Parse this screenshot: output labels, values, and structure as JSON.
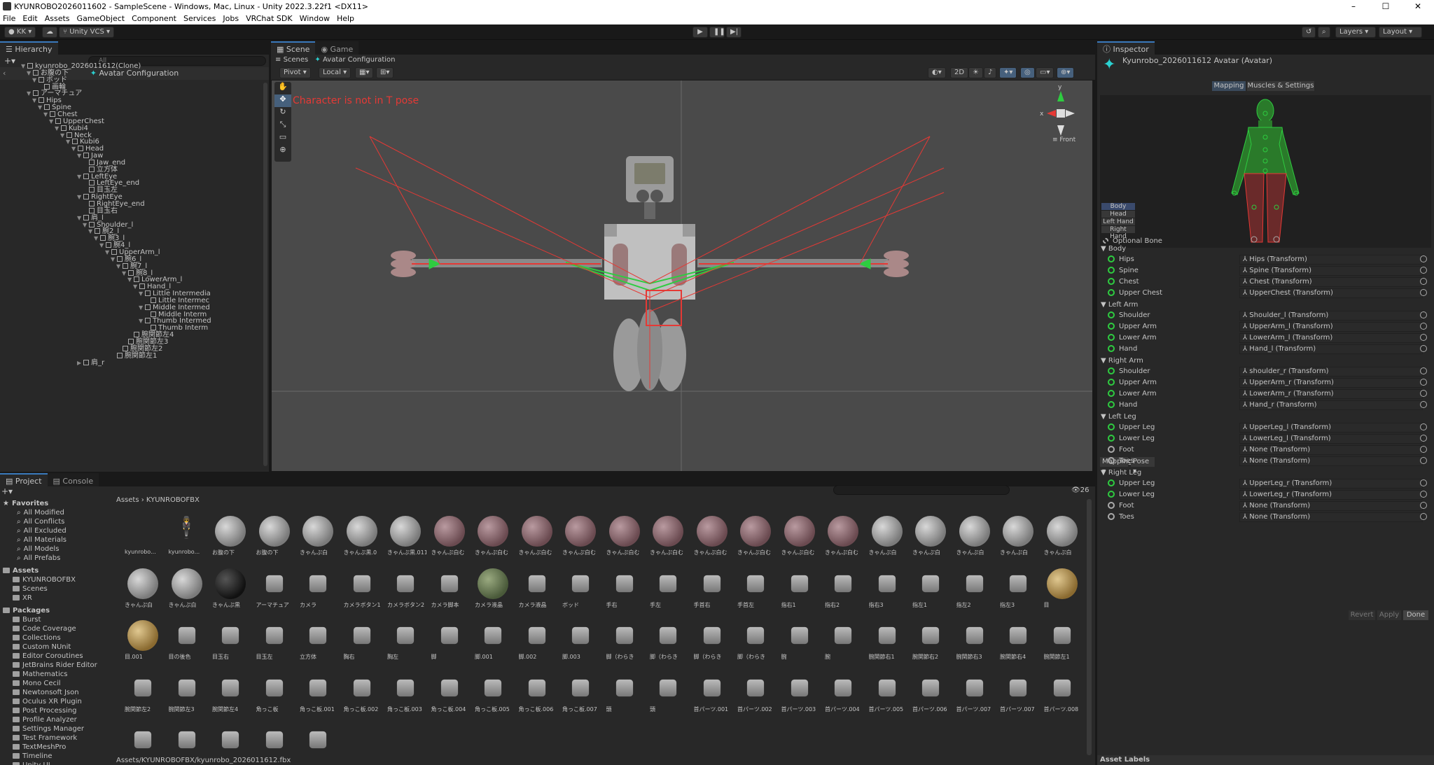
{
  "window": {
    "title": "KYUNROBO2026011602 - SampleScene - Windows, Mac, Linux - Unity 2022.3.22f1 <DX11>",
    "controls": [
      "–",
      "☐",
      "✕"
    ]
  },
  "menu": [
    "File",
    "Edit",
    "Assets",
    "GameObject",
    "Component",
    "Services",
    "Jobs",
    "VRChat SDK",
    "Window",
    "Help"
  ],
  "toolbar": {
    "account": "KK",
    "vcs": "Unity VCS",
    "layers": "Layers",
    "layout": "Layout"
  },
  "hierarchy": {
    "tab": "Hierarchy",
    "search_placeholder": "All",
    "header": "Avatar Configuration",
    "rows": [
      {
        "t": "kyunrobo_2026011612(Clone)",
        "d": 0,
        "a": "▼"
      },
      {
        "t": "お腹の下",
        "d": 1,
        "a": "▼"
      },
      {
        "t": "ボッド",
        "d": 2,
        "a": "▼"
      },
      {
        "t": "画輪",
        "d": 3,
        "a": ""
      },
      {
        "t": "アーマチュア",
        "d": 1,
        "a": "▼"
      },
      {
        "t": "Hips",
        "d": 2,
        "a": "▼"
      },
      {
        "t": "Spine",
        "d": 3,
        "a": "▼"
      },
      {
        "t": "Chest",
        "d": 4,
        "a": "▼"
      },
      {
        "t": "UpperChest",
        "d": 5,
        "a": "▼"
      },
      {
        "t": "Kubi4",
        "d": 6,
        "a": "▼"
      },
      {
        "t": "Neck",
        "d": 7,
        "a": "▼"
      },
      {
        "t": "Kubi6",
        "d": 8,
        "a": "▼"
      },
      {
        "t": "Head",
        "d": 9,
        "a": "▼"
      },
      {
        "t": "Jaw",
        "d": 10,
        "a": "▼"
      },
      {
        "t": "Jaw_end",
        "d": 11,
        "a": ""
      },
      {
        "t": "立方体",
        "d": 11,
        "a": ""
      },
      {
        "t": "LeftEye",
        "d": 10,
        "a": "▼"
      },
      {
        "t": "LeftEye_end",
        "d": 11,
        "a": ""
      },
      {
        "t": "目玉左",
        "d": 11,
        "a": ""
      },
      {
        "t": "RightEye",
        "d": 10,
        "a": "▼"
      },
      {
        "t": "RightEye_end",
        "d": 11,
        "a": ""
      },
      {
        "t": "目玉右",
        "d": 11,
        "a": ""
      },
      {
        "t": "肩_l",
        "d": 10,
        "a": "▼"
      },
      {
        "t": "Shoulder_l",
        "d": 11,
        "a": "▼"
      },
      {
        "t": "腕2_l",
        "d": 12,
        "a": "▼"
      },
      {
        "t": "腕3_l",
        "d": 13,
        "a": "▼"
      },
      {
        "t": "腕4_l",
        "d": 14,
        "a": "▼"
      },
      {
        "t": "UpperArm_l",
        "d": 15,
        "a": "▼"
      },
      {
        "t": "腕6_l",
        "d": 16,
        "a": "▼"
      },
      {
        "t": "腕7_l",
        "d": 17,
        "a": "▼"
      },
      {
        "t": "腕8_l",
        "d": 18,
        "a": "▼"
      },
      {
        "t": "LowerArm_l",
        "d": 19,
        "a": "▼"
      },
      {
        "t": "Hand_l",
        "d": 20,
        "a": "▼"
      },
      {
        "t": "Little Intermedia",
        "d": 21,
        "a": "▼"
      },
      {
        "t": "Little Intermec",
        "d": 22,
        "a": ""
      },
      {
        "t": "Middle Intermed",
        "d": 21,
        "a": "▼"
      },
      {
        "t": "Middle Interm",
        "d": 22,
        "a": ""
      },
      {
        "t": "Thumb Intermed",
        "d": 21,
        "a": "▼"
      },
      {
        "t": "Thumb Interm",
        "d": 22,
        "a": ""
      },
      {
        "t": "腕関節左4",
        "d": 19,
        "a": ""
      },
      {
        "t": "腕関節左3",
        "d": 18,
        "a": ""
      },
      {
        "t": "腕関節左2",
        "d": 17,
        "a": ""
      },
      {
        "t": "腕関節左1",
        "d": 16,
        "a": ""
      },
      {
        "t": "肩_r",
        "d": 10,
        "a": "▶"
      }
    ]
  },
  "scene": {
    "tabs": [
      "Scene",
      "Game"
    ],
    "breadcrumb_root": "Scenes",
    "breadcrumb": "Avatar Configuration",
    "pivot": "Pivot",
    "local": "Local",
    "mode2d": "2D",
    "warning": "Character is not in T pose",
    "view": "Front",
    "gizmo_x": "x",
    "gizmo_y": "y"
  },
  "inspector": {
    "tab": "Inspector",
    "title": "Kyunrobo_2026011612 Avatar (Avatar)",
    "subtabs": [
      "Mapping",
      "Muscles & Settings"
    ],
    "body_buttons": [
      "Body",
      "Head",
      "Left Hand",
      "Right Hand"
    ],
    "optional": "Optional Bone",
    "sections": [
      {
        "name": "Body",
        "bones": [
          {
            "b": "Hips",
            "v": "Hips (Transform)",
            "on": true
          },
          {
            "b": "Spine",
            "v": "Spine (Transform)",
            "on": true
          },
          {
            "b": "Chest",
            "v": "Chest (Transform)",
            "on": true
          },
          {
            "b": "Upper Chest",
            "v": "UpperChest (Transform)",
            "on": true
          }
        ]
      },
      {
        "name": "Left Arm",
        "bones": [
          {
            "b": "Shoulder",
            "v": "Shoulder_l (Transform)",
            "on": true
          },
          {
            "b": "Upper Arm",
            "v": "UpperArm_l (Transform)",
            "on": true
          },
          {
            "b": "Lower Arm",
            "v": "LowerArm_l (Transform)",
            "on": true
          },
          {
            "b": "Hand",
            "v": "Hand_l (Transform)",
            "on": true
          }
        ]
      },
      {
        "name": "Right Arm",
        "bones": [
          {
            "b": "Shoulder",
            "v": "shoulder_r (Transform)",
            "on": true
          },
          {
            "b": "Upper Arm",
            "v": "UpperArm_r (Transform)",
            "on": true
          },
          {
            "b": "Lower Arm",
            "v": "LowerArm_r (Transform)",
            "on": true
          },
          {
            "b": "Hand",
            "v": "Hand_r (Transform)",
            "on": true
          }
        ]
      },
      {
        "name": "Left Leg",
        "bones": [
          {
            "b": "Upper Leg",
            "v": "UpperLeg_l (Transform)",
            "on": true
          },
          {
            "b": "Lower Leg",
            "v": "LowerLeg_l (Transform)",
            "on": true
          },
          {
            "b": "Foot",
            "v": "None (Transform)",
            "on": false
          },
          {
            "b": "Toes",
            "v": "None (Transform)",
            "on": false
          }
        ]
      },
      {
        "name": "Right Leg",
        "bones": [
          {
            "b": "Upper Leg",
            "v": "UpperLeg_r (Transform)",
            "on": true
          },
          {
            "b": "Lower Leg",
            "v": "LowerLeg_r (Transform)",
            "on": true
          },
          {
            "b": "Foot",
            "v": "None (Transform)",
            "on": false
          },
          {
            "b": "Toes",
            "v": "None (Transform)",
            "on": false
          }
        ]
      }
    ],
    "mapping_btn": "Mapping ▾",
    "pose_btn": "Pose ▾",
    "revert": "Revert",
    "apply": "Apply",
    "done": "Done",
    "asset_labels": "Asset Labels"
  },
  "project": {
    "tabs": [
      "Project",
      "Console"
    ],
    "breadcrumb": [
      "Assets",
      "KYUNROBOFBX"
    ],
    "count": "26",
    "path": "Assets/KYUNROBOFBX/kyunrobo_2026011612.fbx",
    "favorites_title": "Favorites",
    "favorites": [
      "All Modified",
      "All Conflicts",
      "All Excluded",
      "All Materials",
      "All Models",
      "All Prefabs"
    ],
    "assets_title": "Assets",
    "assets_folders": [
      "KYUNROBOFBX",
      "Scenes",
      "XR"
    ],
    "packages_title": "Packages",
    "packages": [
      "Burst",
      "Code Coverage",
      "Collections",
      "Custom NUnit",
      "Editor Coroutines",
      "JetBrains Rider Editor",
      "Mathematics",
      "Mono Cecil",
      "Newtonsoft Json",
      "Oculus XR Plugin",
      "Post Processing",
      "Profile Analyzer",
      "Settings Manager",
      "Test Framework",
      "TextMeshPro",
      "Timeline",
      "Unity UI"
    ],
    "items": [
      "kyunrobo...",
      "kyunrobo...",
      "お腹の下",
      "お腹の下",
      "きゃんぷ白",
      "きゃんぷ黒.0",
      "きゃんぷ黒.011",
      "きゃんぷ白む",
      "きゃんぷ白む",
      "きゃんぷ白む",
      "きゃんぷ白む",
      "きゃんぷ白む",
      "きゃんぷ白む",
      "きゃんぷ白む",
      "きゃんぷ白む",
      "きゃんぷ白む",
      "きゃんぷ白む",
      "きゃんぷ白",
      "きゃんぷ白",
      "きゃんぷ白",
      "きゃんぷ白",
      "きゃんぷ白",
      "きゃんぷ白",
      "きゃんぷ白",
      "きゃんぷ黒",
      "アーマチュア",
      "カメラ",
      "カメラボタン1",
      "カメラボタン2",
      "カメラ脚本",
      "カメラ液晶",
      "カメラ液晶",
      "ボッド",
      "手右",
      "手左",
      "手首右",
      "手首左",
      "指右1",
      "指右2",
      "指右3",
      "指左1",
      "指左2",
      "指左3",
      "目",
      "目.001",
      "目の後色",
      "目玉右",
      "目玉左",
      "立方体",
      "胸右",
      "胸左",
      "脚",
      "脚.001",
      "脚.002",
      "脚.003",
      "脚（わらき",
      "脚（わらき",
      "脚（わらき",
      "脚（わらき",
      "腕",
      "腕",
      "腕関節右1",
      "腕関節右2",
      "腕関節右3",
      "腕関節右4",
      "腕関節左1",
      "腕関節左2",
      "腕関節左3",
      "腕関節左4",
      "角っこ板",
      "角っこ板.001",
      "角っこ板.002",
      "角っこ板.003",
      "角っこ板.004",
      "角っこ板.005",
      "角っこ板.006",
      "角っこ板.007",
      "頭",
      "頭",
      "首パーツ.001",
      "首パーツ.002",
      "首パーツ.003",
      "首パーツ.004",
      "首パーツ.005",
      "首パーツ.006",
      "首パーツ.007",
      "首パーツ.007",
      "首パーツ.008",
      "",
      "",
      "",
      "",
      ""
    ]
  },
  "colors": {
    "accent": "#3a79bb",
    "bone_green": "#2ecc40",
    "bone_red": "#e53935",
    "warning": "#e53935"
  }
}
